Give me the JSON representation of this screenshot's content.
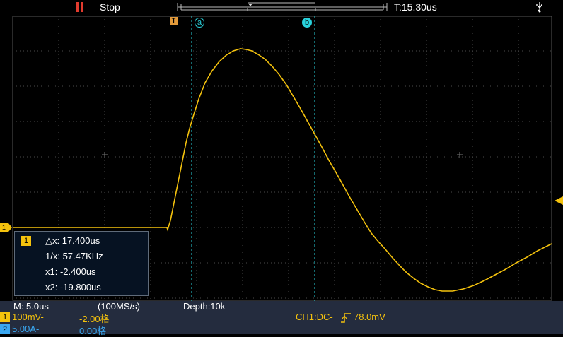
{
  "top": {
    "run_status": "Stop",
    "time_position": "T:15.30us"
  },
  "cursors": {
    "a_label": "a",
    "b_label": "b"
  },
  "trigger_marker": "T",
  "channel_marker_left": "1",
  "measure": {
    "channel": "1",
    "dx": "△x: 17.400us",
    "inv_dx": "1/x: 57.47KHz",
    "x1": "x1: -2.400us",
    "x2": "x2: -19.800us"
  },
  "bottom": {
    "timebase": "M: 5.0us",
    "sample_rate": "(100MS/s)",
    "depth": "Depth:10k",
    "ch1_num": "1",
    "ch1_scale": "100mV-",
    "ch1_offset": "-2.00格",
    "ch2_num": "2",
    "ch2_scale": "5.00A-",
    "ch2_offset": "0.00格",
    "trigger_prefix": "CH1:DC-",
    "trigger_level": "78.0mV"
  },
  "colors": {
    "ch1": "#f4c20d",
    "ch2": "#3aa7f0",
    "cursor": "#29d2dc",
    "grid": "#4a4a4a"
  },
  "icons": [
    "run-stop-icon",
    "usb-icon",
    "trigger-marker-icon",
    "rising-edge-icon"
  ]
}
